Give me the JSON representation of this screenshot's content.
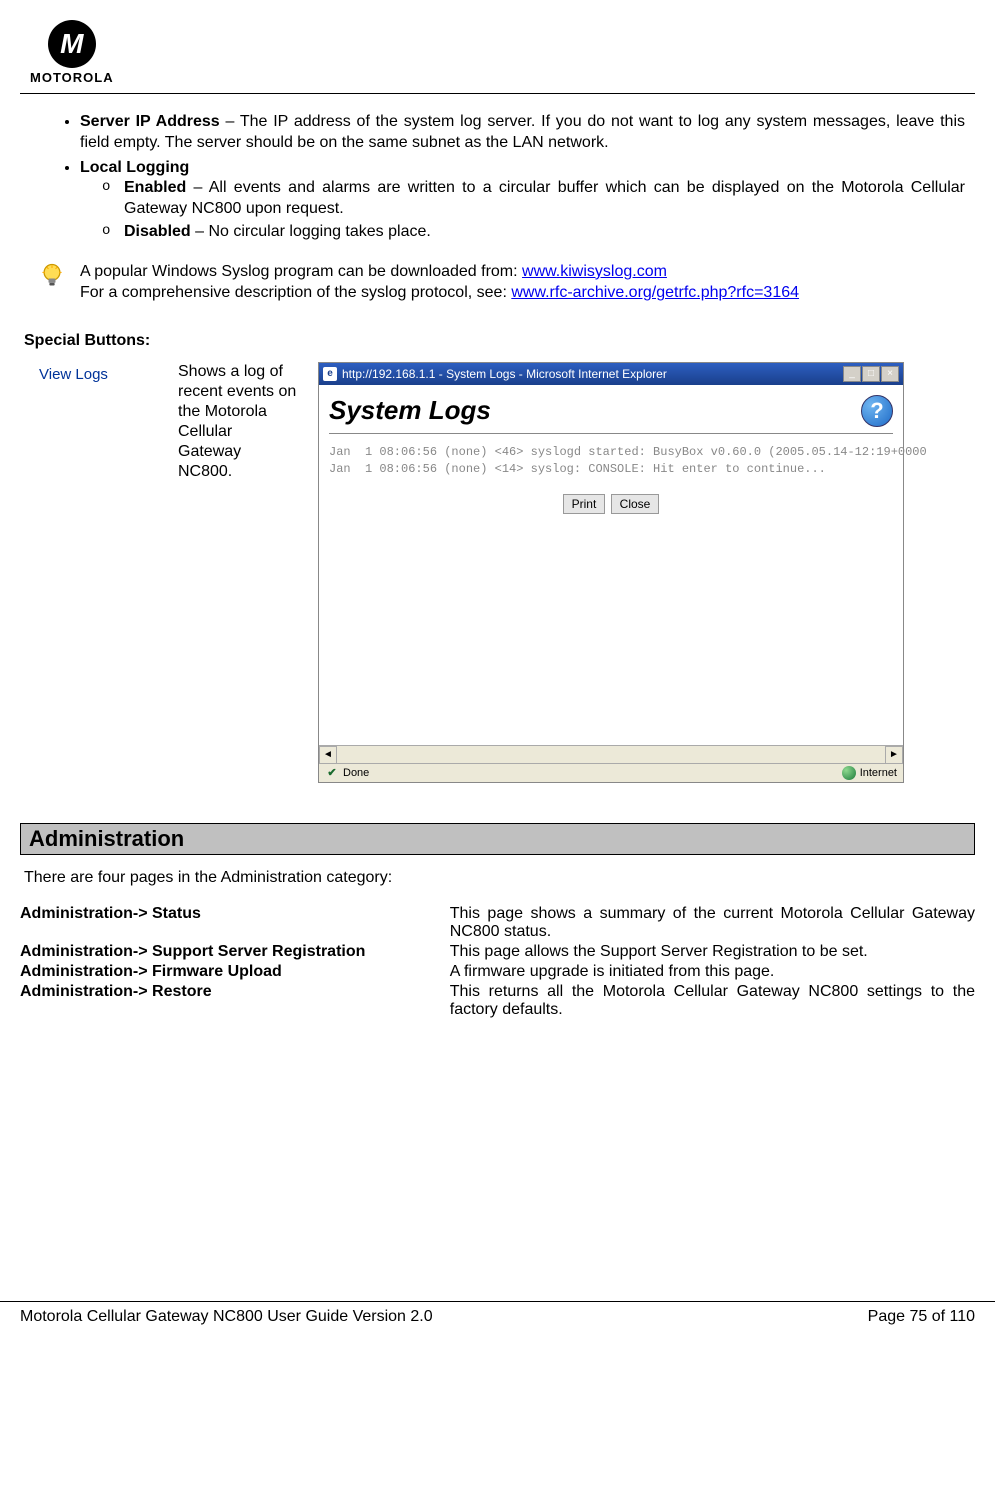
{
  "brand": "MOTOROLA",
  "logo_letter": "M",
  "bullets": {
    "server_ip_label": "Server IP Address",
    "server_ip_text": " – The IP address of the system log server. If you do not want to log any system messages, leave this field empty. The server should be on the same subnet as the LAN network.",
    "local_logging_label": "Local Logging",
    "enabled_label": "Enabled",
    "enabled_text": " – All events and alarms are written to a circular buffer which can be displayed on the Motorola Cellular Gateway NC800 upon request.",
    "disabled_label": "Disabled",
    "disabled_text": " – No circular logging takes place."
  },
  "tip": {
    "line1_pre": "A popular Windows Syslog program can be downloaded from: ",
    "line1_link": "www.kiwisyslog.com",
    "line2_pre": "For a comprehensive description of the syslog protocol, see:  ",
    "line2_link": "www.rfc-archive.org/getrfc.php?rfc=3164"
  },
  "special_heading": "Special Buttons:",
  "viewlogs_button": "View Logs",
  "viewlogs_desc": "Shows a log of recent events on the Motorola Cellular Gateway NC800.",
  "browser": {
    "title": "http://192.168.1.1 - System Logs - Microsoft Internet Explorer",
    "sys_heading": "System Logs",
    "log_line1": "Jan  1 08:06:56 (none) <46> syslogd started: BusyBox v0.60.0 (2005.05.14-12:19+0000",
    "log_line2": "Jan  1 08:06:56 (none) <14> syslog: CONSOLE: Hit enter to continue...",
    "print_btn": "Print",
    "close_btn": "Close",
    "status_done": "Done",
    "status_zone": "Internet"
  },
  "admin": {
    "heading": "Administration",
    "intro": "There are four pages in the Administration category:",
    "rows": [
      {
        "left": "Administration-> Status",
        "right": "This page shows a summary of the current Motorola Cellular Gateway NC800 status."
      },
      {
        "left": "Administration-> Support Server Registration",
        "right": "This page allows the Support Server Registration to be set."
      },
      {
        "left": "Administration-> Firmware Upload",
        "right": "A firmware upgrade is initiated from this page."
      },
      {
        "left": "Administration-> Restore",
        "right": "This returns all the Motorola Cellular Gateway NC800 settings to the factory defaults."
      }
    ]
  },
  "footer": {
    "left": "Motorola Cellular Gateway NC800 User Guide Version 2.0",
    "right": "Page 75 of 110"
  }
}
